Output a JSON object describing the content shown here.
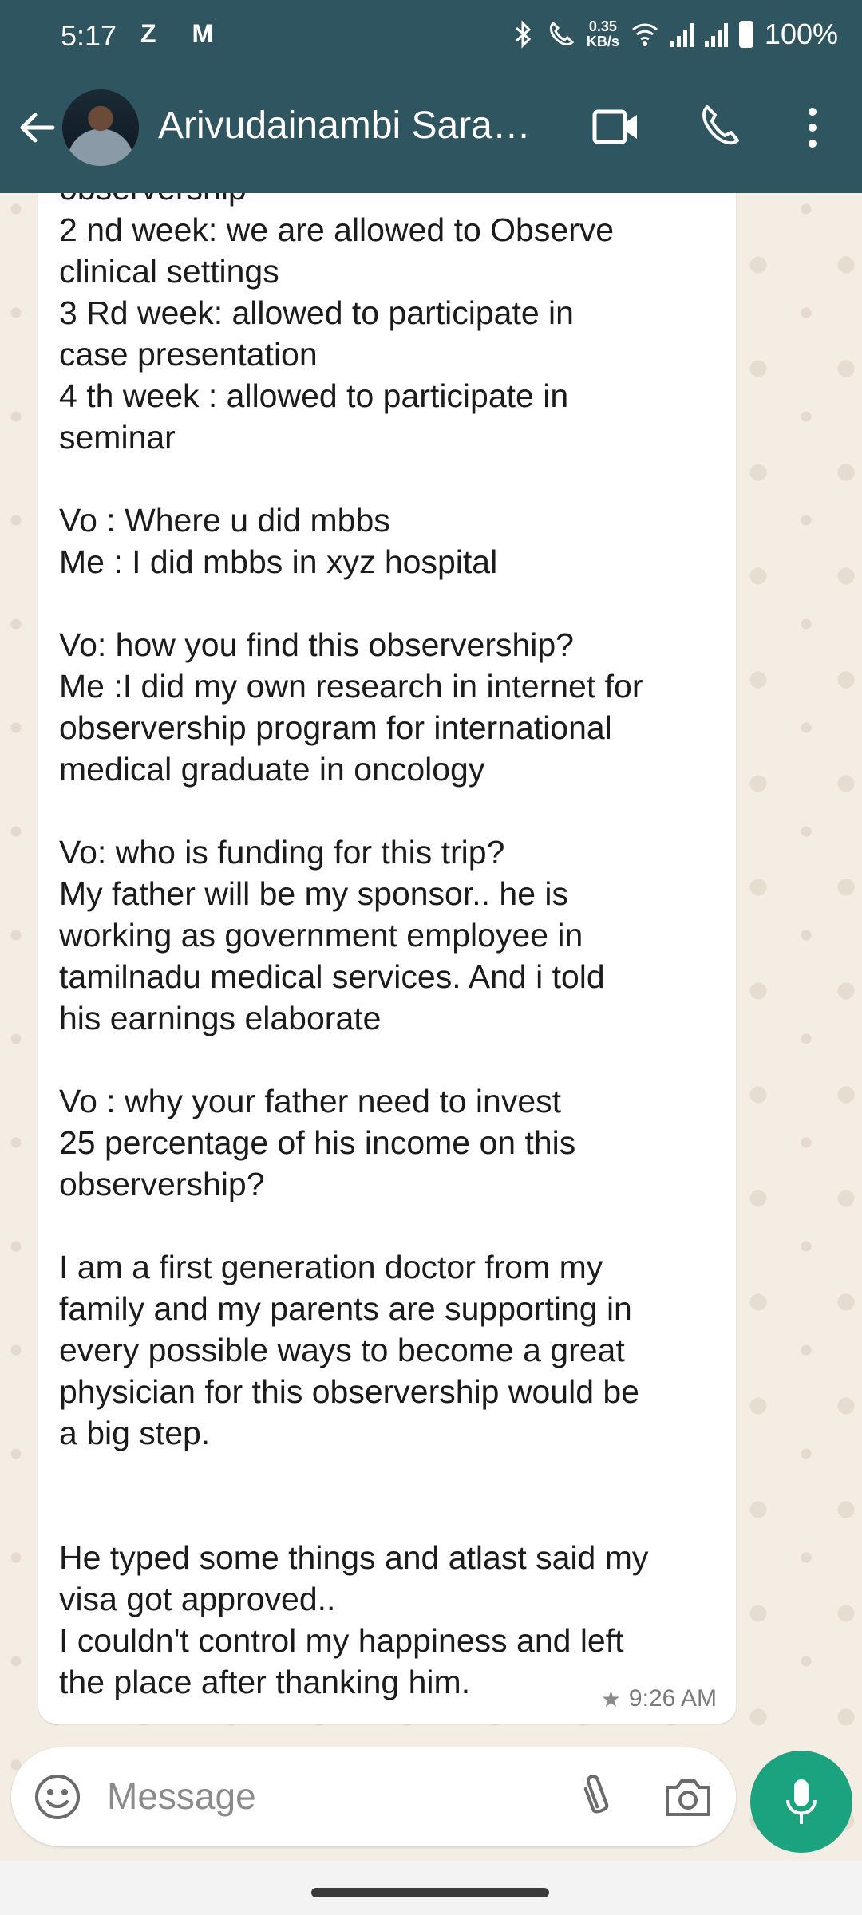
{
  "status_bar": {
    "time": "5:17",
    "left_icons": "Z M",
    "net_speed_value": "0.35",
    "net_speed_unit": "KB/s",
    "battery": "100%"
  },
  "header": {
    "contact_name": "Arivudainambi Sara…",
    "accent_color": "#2f5560"
  },
  "message": {
    "lines": [
      "observership",
      "2 nd week: we are allowed to Observe",
      "clinical settings",
      "3 Rd week: allowed to participate in",
      "case presentation",
      "4 th week : allowed to participate in",
      "seminar",
      "",
      "Vo : Where u did mbbs",
      "Me : I did mbbs in xyz hospital",
      "",
      "Vo: how you find this observership?",
      "Me :I did my own research in internet for",
      "observership program for international",
      "medical graduate in oncology",
      "",
      "Vo: who is funding for this trip?",
      "My father will be my sponsor.. he is",
      "working as government employee in",
      "tamilnadu medical services. And i told",
      "his earnings elaborate",
      "",
      "Vo : why your father need to invest",
      "25 percentage of his income on this",
      "observership?",
      "",
      "I am a first generation doctor from my",
      "family and my parents are supporting in",
      "every possible ways to become a great",
      "physician for this observership would be",
      "a big step.",
      "",
      "",
      "He typed some things and atlast said my",
      "visa got approved..",
      "I couldn't control my happiness and left",
      "the place after thanking him."
    ],
    "time": "9:26 AM",
    "starred_icon": "star-icon"
  },
  "composer": {
    "placeholder": "Message",
    "mic_color": "#1aa37e"
  }
}
